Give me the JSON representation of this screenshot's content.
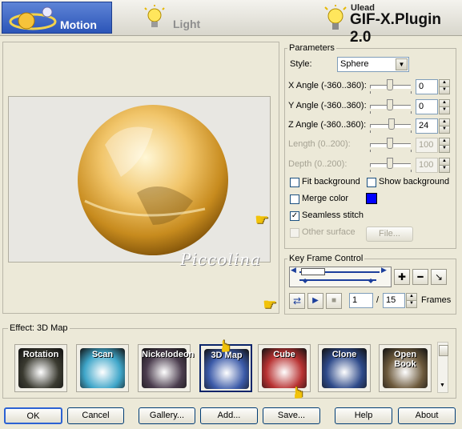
{
  "tabs": [
    {
      "label": "Motion",
      "active": true
    },
    {
      "label": "Light",
      "active": false
    }
  ],
  "brand": {
    "vendor": "Ulead",
    "product": "GIF-X.Plugin 2.0"
  },
  "preview": {
    "watermark": "Piccolina"
  },
  "parameters": {
    "title": "Parameters",
    "style_label": "Style:",
    "style_value": "Sphere",
    "sliders": [
      {
        "label": "X Angle (-360..360):",
        "value": "0",
        "fraction": 0.5,
        "enabled": true
      },
      {
        "label": "Y Angle (-360..360):",
        "value": "0",
        "fraction": 0.5,
        "enabled": true
      },
      {
        "label": "Z Angle (-360..360):",
        "value": "24",
        "fraction": 0.53,
        "enabled": true
      },
      {
        "label": "Length (0..200):",
        "value": "100",
        "fraction": 0.5,
        "enabled": false
      },
      {
        "label": "Depth (0..200):",
        "value": "100",
        "fraction": 0.5,
        "enabled": false
      }
    ],
    "fit_background": {
      "label": "Fit background",
      "checked": false
    },
    "show_background": {
      "label": "Show background",
      "checked": false
    },
    "merge_color": {
      "label": "Merge color",
      "checked": false,
      "color": "#0000ff"
    },
    "seamless_stitch": {
      "label": "Seamless stitch",
      "checked": true
    },
    "other_surface": {
      "label": "Other surface",
      "checked": false,
      "enabled": false
    },
    "file_button": "File..."
  },
  "keyframe": {
    "title": "Key Frame Control",
    "current_frame": "1",
    "separator": "/",
    "total_frames": "15",
    "frames_label": "Frames"
  },
  "effects": {
    "title": "Effect: 3D Map",
    "items": [
      {
        "label": "Rotation",
        "color": "#3a3a30"
      },
      {
        "label": "Scan",
        "color": "#3fa6c9"
      },
      {
        "label": "Nickelodeon",
        "color": "#4b3d4e"
      },
      {
        "label": "3D Map",
        "color": "#3b5aa8",
        "selected": true
      },
      {
        "label": "Cube",
        "color": "#b83232"
      },
      {
        "label": "Clone",
        "color": "#2e4a8a"
      },
      {
        "label": "Open Book",
        "color": "#6d5a3c"
      }
    ]
  },
  "buttons": {
    "ok": "OK",
    "cancel": "Cancel",
    "gallery": "Gallery...",
    "add": "Add...",
    "save": "Save...",
    "help": "Help",
    "about": "About"
  },
  "accent": "#2c55b8"
}
